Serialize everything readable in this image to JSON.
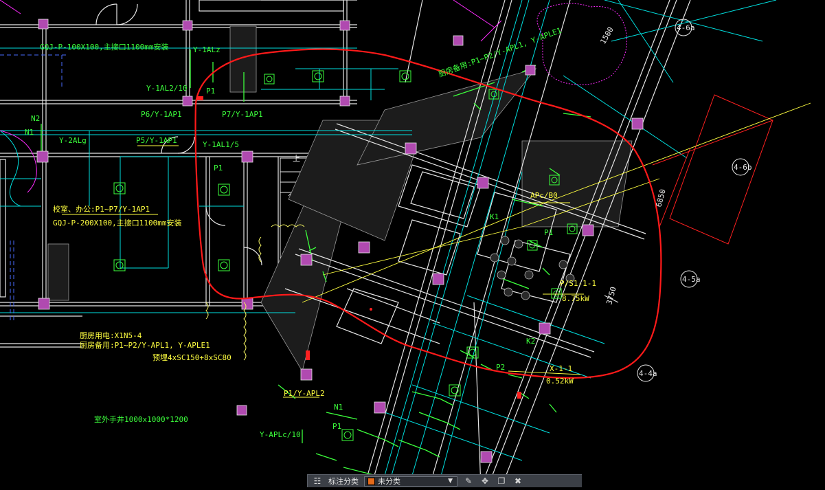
{
  "drawing": {
    "texts": [
      {
        "t": "GQJ-P-100X100,主接口1100mm安装",
        "c": "#3cff3c"
      },
      {
        "t": "Y-1ALz",
        "c": "#3cff3c"
      },
      {
        "t": "Y-1AL2/10",
        "c": "#3cff3c"
      },
      {
        "t": "P1",
        "c": "#3cff3c"
      },
      {
        "t": "P6/Y-1AP1",
        "c": "#3cff3c"
      },
      {
        "t": "P7/Y-1AP1",
        "c": "#3cff3c"
      },
      {
        "t": "P5/Y-1AP1",
        "c": "#3cff3c"
      },
      {
        "t": "Y-2ALg",
        "c": "#3cff3c"
      },
      {
        "t": "Y-1AL1/5",
        "c": "#3cff3c"
      },
      {
        "t": "P1",
        "c": "#3cff3c"
      },
      {
        "t": "N1",
        "c": "#3cff3c"
      },
      {
        "t": "N2",
        "c": "#3cff3c"
      },
      {
        "t": "校室、办公:P1~P7/Y-1AP1",
        "c": "#ffff40"
      },
      {
        "t": "GQJ-P-200X100,主接口1100mm安装",
        "c": "#ffff40"
      },
      {
        "t": "厨房用电:X1N5-4",
        "c": "#ffff40"
      },
      {
        "t": "厨房备用:P1~P2/Y-APL1, Y-APLE1",
        "c": "#ffff40"
      },
      {
        "t": "预埋4xSC150+8xSC80",
        "c": "#ffff40"
      },
      {
        "t": "室外手井1000x1000*1200",
        "c": "#3cff3c"
      },
      {
        "t": "P1/Y-APL2",
        "c": "#ffff40"
      },
      {
        "t": "N1",
        "c": "#3cff3c"
      },
      {
        "t": "P1",
        "c": "#3cff3c"
      },
      {
        "t": "Y-APLc/10",
        "c": "#3cff3c"
      },
      {
        "t": "APc/B0",
        "c": "#ffff40"
      },
      {
        "t": "K1",
        "c": "#3cff3c"
      },
      {
        "t": "P1",
        "c": "#3cff3c"
      },
      {
        "t": "P/S1-1-1",
        "c": "#ffff40"
      },
      {
        "t": "8.75kW",
        "c": "#ffff40"
      },
      {
        "t": "K2",
        "c": "#3cff3c"
      },
      {
        "t": "P2",
        "c": "#3cff3c"
      },
      {
        "t": "X-1-1",
        "c": "#ffff40"
      },
      {
        "t": "0.52kW",
        "c": "#ffff40"
      },
      {
        "t": "厨房备用:P1~P2/Y-APL1, Y-APLE1",
        "c": "#3cff3c"
      },
      {
        "t": "4-6a",
        "c": "#e8e8e8"
      },
      {
        "t": "4-6b",
        "c": "#e8e8e8"
      },
      {
        "t": "4-5a",
        "c": "#e8e8e8"
      },
      {
        "t": "4-4a",
        "c": "#e8e8e8"
      },
      {
        "t": "1500",
        "c": "#e8e8e8"
      },
      {
        "t": "6850",
        "c": "#e8e8e8"
      },
      {
        "t": "3750",
        "c": "#e8e8e8"
      },
      {
        "t": "上",
        "c": "#e8e8e8"
      }
    ]
  },
  "status_bar": {
    "annotate_scale_label": "标注分类",
    "layer_name": "未分类",
    "layer_color": "#e46a1a"
  }
}
